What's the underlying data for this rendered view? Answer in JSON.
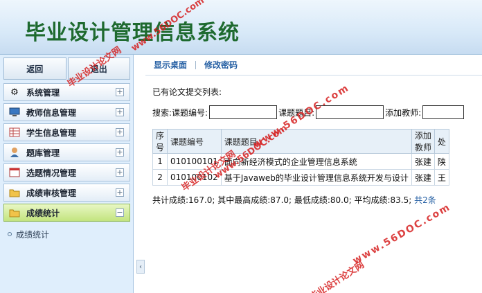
{
  "app": {
    "title": "毕业设计管理信息系统"
  },
  "sidebar": {
    "back_label": "返回",
    "second_label": "退出",
    "items": [
      {
        "label": "系统管理",
        "icon": "gear-icon",
        "toggle": "+"
      },
      {
        "label": "教师信息管理",
        "icon": "monitor-icon",
        "toggle": "+"
      },
      {
        "label": "学生信息管理",
        "icon": "table-icon",
        "toggle": "+"
      },
      {
        "label": "题库管理",
        "icon": "user-icon",
        "toggle": "+"
      },
      {
        "label": "选题情况管理",
        "icon": "window-icon",
        "toggle": "+"
      },
      {
        "label": "成绩审核管理",
        "icon": "folder-icon",
        "toggle": "+"
      },
      {
        "label": "成绩统计",
        "icon": "folder-icon",
        "toggle": "−"
      }
    ],
    "submenu": [
      {
        "label": "成绩统计"
      }
    ],
    "collapse_glyph": "‹"
  },
  "tabs": {
    "desktop": "显示桌面",
    "password": "修改密码"
  },
  "main": {
    "heading": "已有论文提交列表:",
    "search": {
      "label": "搜索:",
      "code_label": "课题编号:",
      "topic_label": "课题题目:",
      "teacher_label": "添加教师:"
    },
    "table": {
      "headers": [
        "序号",
        "课题编号",
        "课题题目",
        "添加教师",
        "处"
      ],
      "rows": [
        [
          "1",
          "010100101",
          "面向新经济模式的企业管理信息系统",
          "张建",
          "陕"
        ],
        [
          "2",
          "010100102",
          "基于Javaweb的毕业设计管理信息系统开发与设计",
          "张建",
          "王"
        ]
      ]
    },
    "stats": {
      "text": "共计成绩:167.0; 其中最高成绩:87.0; 最低成绩:80.0; 平均成绩:83.5;",
      "count_link": "共2条"
    }
  },
  "watermarks": [
    "www.56DOC.com",
    "毕业设计论文网"
  ]
}
